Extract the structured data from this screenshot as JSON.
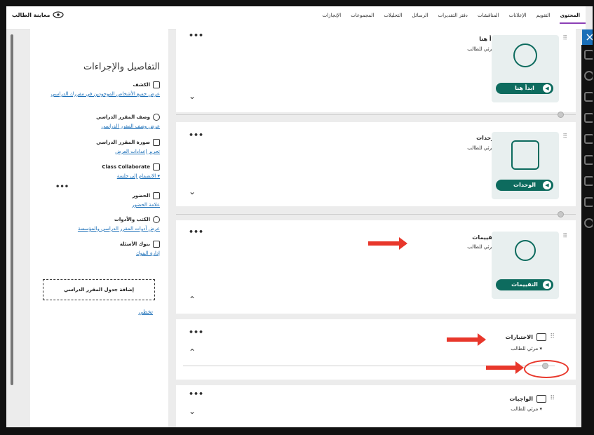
{
  "topnav": {
    "tabs": [
      "المحتوى",
      "التقويم",
      "الإعلانات",
      "المناقشات",
      "دفتر التقديرات",
      "الرسائل",
      "التحليلات",
      "المجموعات",
      "الإنجازات"
    ],
    "student_preview": "معاينة الطالب"
  },
  "sidebar": {
    "title": "التفاصيل والإجراءات",
    "items": [
      {
        "title": "الكشف",
        "link": "عرض جميع الأشخاص الموجودين في مقررك الدراسي"
      },
      {
        "title": "وصف المقرر الدراسي",
        "link": "عرض وصف المقرر الدراسي"
      },
      {
        "title": "صورة المقرر الدراسي",
        "link": "تحرير إعدادات العرض"
      },
      {
        "title": "Class Collaborate",
        "link": "الانضمام إلى جلسة ▾"
      },
      {
        "title": "الحضور",
        "link": "علامة الحضور"
      },
      {
        "title": "الكتب والأدوات",
        "link": "عرض أدوات المقرر الدراسي والمؤسسة"
      },
      {
        "title": "بنوك الأسئلة",
        "link": "إدارة البنوك"
      }
    ],
    "add_schedule": "إضافة جدول المقرر الدراسي",
    "skip": "تخطي"
  },
  "content": {
    "items": [
      {
        "name": "ابدأ هنا",
        "visibility": "مرئي للطالب ▾",
        "thumb_label": "ابدأ هنا"
      },
      {
        "name": "الوحدات",
        "visibility": "مرئي للطالب ▾",
        "thumb_label": "الوحدات"
      },
      {
        "name": "التقييمات",
        "visibility": "مرئي للطالب ▾",
        "thumb_label": "التقييمات"
      }
    ],
    "folders": [
      {
        "name": "الاختبارات",
        "visibility": "مرئي للطالب ▾"
      },
      {
        "name": "الواجبات",
        "visibility": "مرئي للطالب ▾"
      }
    ]
  },
  "colors": {
    "accent": "#8b3fb5",
    "brand": "#0d6b5e",
    "annotation": "#e8372b",
    "close": "#1b6fb8"
  }
}
